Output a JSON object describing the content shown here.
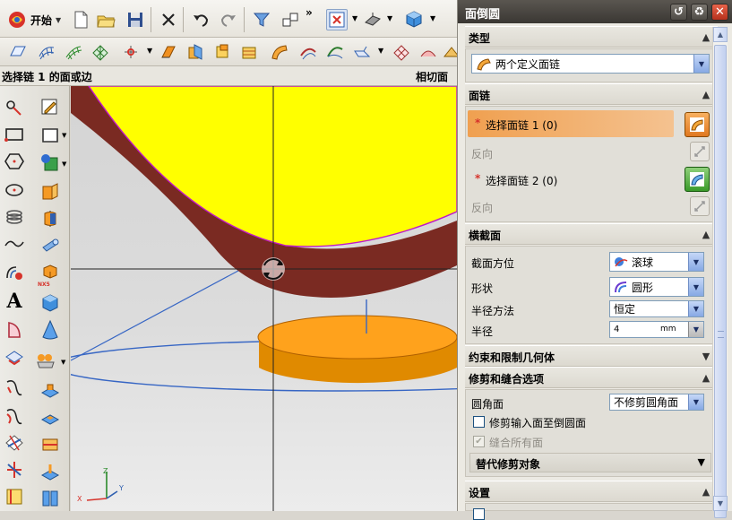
{
  "toolbar": {
    "start_label": "开始",
    "more_glyph": "»"
  },
  "statusbar": {
    "prompt": "选择链 1 的面或边",
    "mode_label": "相切面"
  },
  "dialog": {
    "title": "面倒圆",
    "type_section": {
      "heading": "类型",
      "value": "两个定义面链"
    },
    "facechain_section": {
      "heading": "面链",
      "chain1_label": "选择面链 1 (0)",
      "reverse1_label": "反向",
      "chain2_label": "选择面链 2 (0)",
      "reverse2_label": "反向",
      "required_mark": "*"
    },
    "cross_section": {
      "heading": "横截面",
      "orientation_label": "截面方位",
      "orientation_value": "滚球",
      "shape_label": "形状",
      "shape_value": "圆形",
      "radius_method_label": "半径方法",
      "radius_method_value": "恒定",
      "radius_label": "半径",
      "radius_value": "4",
      "radius_unit": "mm"
    },
    "constraint_section": {
      "heading": "约束和限制几何体"
    },
    "trim_section": {
      "heading": "修剪和缝合选项",
      "fillet_face_label": "圆角面",
      "fillet_face_value": "不修剪圆角面",
      "trim_input_label": "修剪输入面至倒圆面",
      "sew_all_label": "缝合所有面",
      "alt_trim_label": "替代修剪对象"
    },
    "settings_section": {
      "heading": "设置"
    }
  },
  "viewport": {
    "axis_x": "X",
    "axis_y": "Y",
    "axis_z": "Z"
  },
  "left_tools": {
    "text_tool_glyph": "A",
    "nx5_badge": "NX5"
  },
  "colors": {
    "surface_top": "#ffff00",
    "surface_side": "#7a2a22",
    "cylinder": "#ff9900",
    "selection_highlight": "#f0a050",
    "title_bar": "#4a4641"
  }
}
